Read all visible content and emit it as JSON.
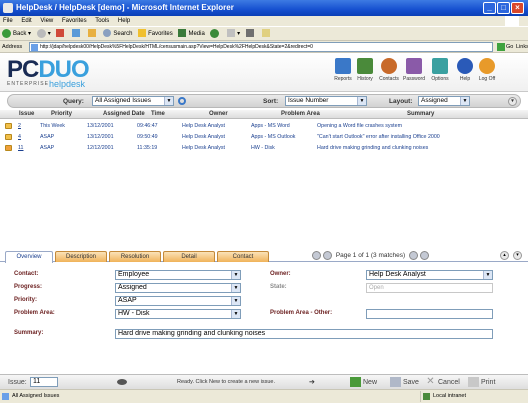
{
  "window": {
    "title": "HelpDesk / HelpDesk [demo] - Microsoft Internet Explorer"
  },
  "menu": [
    "File",
    "Edit",
    "View",
    "Favorites",
    "Tools",
    "Help"
  ],
  "toolbar": {
    "back": "Back",
    "search": "Search",
    "favorites": "Favorites",
    "media": "Media"
  },
  "address": {
    "label": "Address",
    "url": "http://jdap/helpdesk00/HelpDesk%5FHelpDesk/HTML/censusmain.asp?View=HelpDesk%2FHelpDesk&State=2&redirect=0",
    "go": "Go",
    "links": "Links"
  },
  "logo": {
    "pc": "PC",
    "duo": "DUO",
    "enterprise": "ENTERPRISE",
    "helpdesk": "helpdesk"
  },
  "header_icons": [
    {
      "label": "Reports",
      "icon": "chart-icon",
      "color": "#3a78c8"
    },
    {
      "label": "History",
      "icon": "history-icon",
      "color": "#4a8a3a"
    },
    {
      "label": "Contacts",
      "icon": "contacts-icon",
      "color": "#c86a2a"
    },
    {
      "label": "Password",
      "icon": "password-icon",
      "color": "#8a5aa8"
    },
    {
      "label": "Options",
      "icon": "options-icon",
      "color": "#3aa0a0"
    },
    {
      "label": "Help",
      "icon": "help-icon",
      "color": "#2a5ab8"
    },
    {
      "label": "Log Off",
      "icon": "logoff-icon",
      "color": "#e89a2a"
    }
  ],
  "query": {
    "label": "Query:",
    "value": "All Assigned Issues",
    "sort_label": "Sort:",
    "sort_value": "Issue Number",
    "layout_label": "Layout:",
    "layout_value": "Assigned"
  },
  "list": {
    "columns": [
      "Issue",
      "Priority",
      "Assigned Date",
      "Time",
      "Owner",
      "Problem Area",
      "Summary"
    ],
    "rows": [
      {
        "issue": "2",
        "priority": "This Week",
        "date": "13/12/2001",
        "time": "09:46:47",
        "owner": "Help Desk Analyst",
        "area": "Apps - MS Word",
        "summary": "Opening a Word file crashes system"
      },
      {
        "issue": "4",
        "priority": "ASAP",
        "date": "13/12/2001",
        "time": "09:50:49",
        "owner": "Help Desk Analyst",
        "area": "Apps - MS Outlook",
        "summary": "\"Can't start Outlook\" error after installing Office 2000"
      },
      {
        "issue": "11",
        "priority": "ASAP",
        "date": "12/12/2001",
        "time": "11:35:19",
        "owner": "Help Desk Analyst",
        "area": "HW - Disk",
        "summary": "Hard drive making grinding and clunking noises"
      }
    ]
  },
  "tabs": [
    "Overview",
    "Description",
    "Resolution",
    "Detail",
    "Contact"
  ],
  "pager": {
    "text": "Page 1 of 1 (3 matches)"
  },
  "form": {
    "contact_label": "Contact:",
    "contact_value": "Employee",
    "progress_label": "Progress:",
    "progress_value": "Assigned",
    "priority_label": "Priority:",
    "priority_value": "ASAP",
    "area_label": "Problem Area:",
    "area_value": "HW - Disk",
    "summary_label": "Summary:",
    "summary_value": "Hard drive making grinding and clunking noises",
    "owner_label": "Owner:",
    "owner_value": "Help Desk Analyst",
    "state_label": "State:",
    "state_value": "Open",
    "other_label": "Problem Area - Other:",
    "other_value": ""
  },
  "bottom": {
    "issue_label": "Issue:",
    "issue_value": "11",
    "status_text": "Ready. Click New to create a new issue.",
    "new": "New",
    "save": "Save",
    "cancel": "Cancel",
    "print": "Print"
  },
  "status": {
    "text": "All Assigned Issues",
    "zone": "Local intranet"
  }
}
